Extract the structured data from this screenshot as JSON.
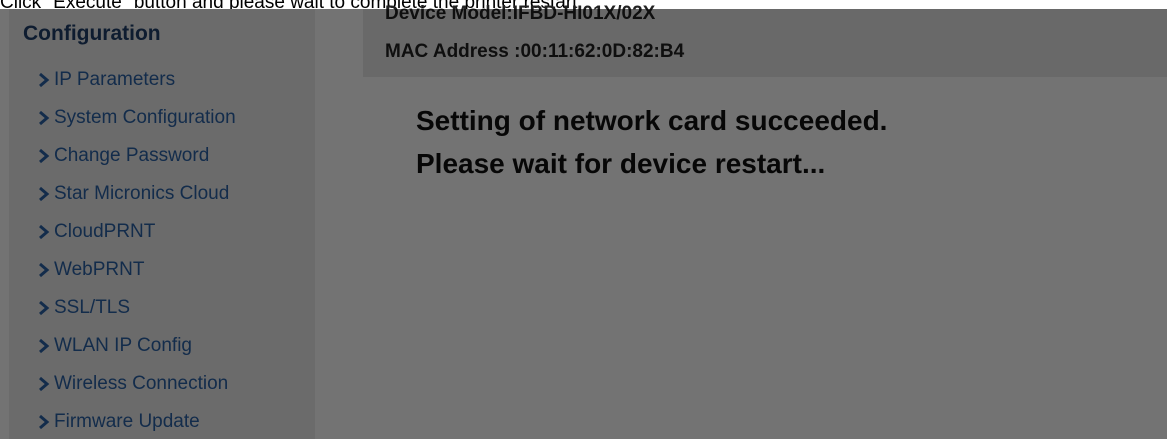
{
  "instruction_text": "Click \"Execute\" button and please wait to complete the printer restart.",
  "sidebar": {
    "title": "Configuration",
    "items": [
      {
        "label": "IP Parameters"
      },
      {
        "label": "System Configuration"
      },
      {
        "label": "Change Password"
      },
      {
        "label": "Star Micronics Cloud"
      },
      {
        "label": "CloudPRNT"
      },
      {
        "label": "WebPRNT"
      },
      {
        "label": "SSL/TLS"
      },
      {
        "label": "WLAN IP Config"
      },
      {
        "label": "Wireless Connection"
      },
      {
        "label": "Firmware Update"
      }
    ],
    "item_icon": "chevron-right-icon"
  },
  "device_info": {
    "model": "Device Model:IFBD-HI01X/02X",
    "mac": "MAC Address :00:11:62:0D:82:B4"
  },
  "status": {
    "line1": "Setting of network card succeeded.",
    "line2": "Please wait for device restart..."
  },
  "colors": {
    "link": "#2b62a7",
    "heading": "#1f3f6a",
    "overlay": "rgba(0,0,0,0.55)"
  }
}
